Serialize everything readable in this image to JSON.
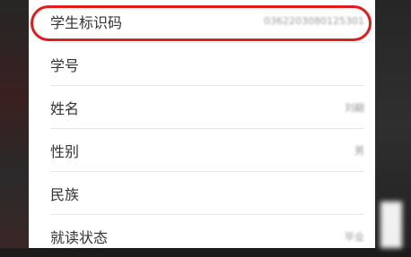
{
  "rows": [
    {
      "label": "学生标识码",
      "value": "0362203080125301"
    },
    {
      "label": "学号",
      "value": ""
    },
    {
      "label": "姓名",
      "value": "刘翩"
    },
    {
      "label": "性别",
      "value": "男"
    },
    {
      "label": "民族",
      "value": ""
    },
    {
      "label": "就读状态",
      "value": "毕业"
    }
  ],
  "annotation": {
    "color": "#e21b1b",
    "shape": "rounded-ellipse",
    "target": "学生标识码"
  }
}
